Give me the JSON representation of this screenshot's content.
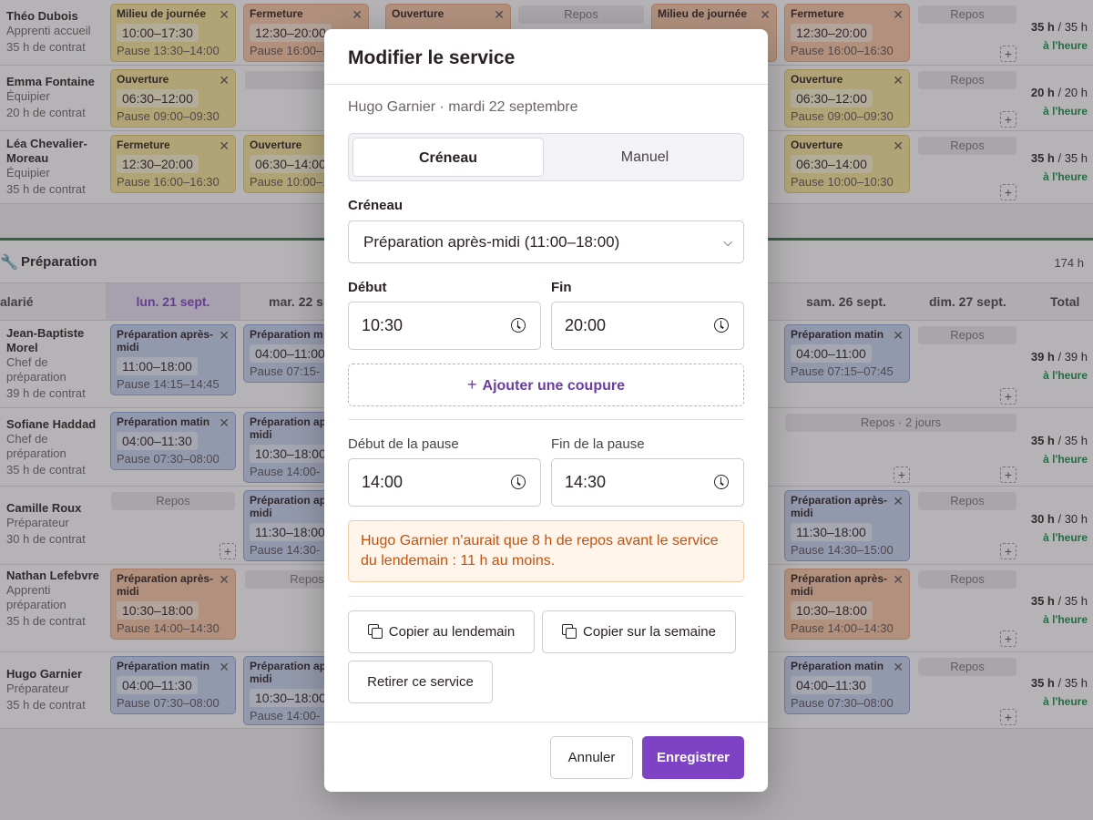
{
  "schedule": {
    "top_rows": [
      {
        "name": "Théo Dubois",
        "role": "Apprenti accueil",
        "contract": "35 h de contrat",
        "total": "35 h / 35 h",
        "total_bold": "35 h",
        "total_rest": " / 35 h",
        "status": "à l'heure"
      },
      {
        "name": "Emma Fontaine",
        "role": "Équipier",
        "contract": "20 h de contrat",
        "total_bold": "20 h",
        "total_rest": " / 20 h",
        "status": "à l'heure"
      },
      {
        "name": "Léa Chevalier-Moreau",
        "role": "Équipier",
        "contract": "35 h de contrat",
        "total_bold": "35 h",
        "total_rest": " / 35 h",
        "status": "à l'heure"
      }
    ],
    "top_shifts": [
      {
        "title": "Milieu de journée",
        "time": "10:00–17:30",
        "pause": "Pause 13:30–14:00"
      },
      {
        "title": "Fermeture",
        "time": "12:30–20:00",
        "pause": "Pause 16:00–16:30"
      },
      {
        "title": "Ouverture",
        "time": "",
        "pause": ""
      },
      {
        "title": "Milieu de journée",
        "time": "",
        "pause": ""
      },
      {
        "title": "Fermeture",
        "time": "12:30–20:00",
        "pause": "Pause 16:00–16:30"
      },
      {
        "title": "Ouverture",
        "time": "06:30–12:00",
        "pause": "Pause 09:00–09:30"
      },
      {
        "title": "Ouverture",
        "time": "06:30–12:00",
        "pause": "Pause 09:00–09:30"
      },
      {
        "title": "Fermeture",
        "time": "12:30–20:00",
        "pause": "Pause 16:00–16:30"
      },
      {
        "title": "Ouverture",
        "time": "06:30–14:00",
        "pause": "Pause 10:00–10:30"
      },
      {
        "title": "Ouverture",
        "time": "06:30–14:00",
        "pause": "Pause 10:00–10:30"
      }
    ],
    "repos_label": "Repos",
    "repos_two_days": "Repos · 2 jours",
    "section": {
      "name": "Préparation",
      "hours": "174 h"
    },
    "columns": {
      "employee": "alarié",
      "mon": "lun. 21 sept.",
      "tue": "mar. 22 s",
      "sat": "sam. 26 sept.",
      "sun": "dim. 27 sept.",
      "total": "Total"
    },
    "prep_rows": [
      {
        "name": "Jean-Baptiste Morel",
        "role": "Chef de préparation",
        "contract": "39 h de contrat",
        "total_bold": "39 h",
        "total_rest": " / 39 h",
        "status": "à l'heure"
      },
      {
        "name": "Sofiane Haddad",
        "role": "Chef de préparation",
        "contract": "35 h de contrat",
        "total_bold": "35 h",
        "total_rest": " / 35 h",
        "status": "à l'heure"
      },
      {
        "name": "Camille Roux",
        "role": "Préparateur",
        "contract": "30 h de contrat",
        "total_bold": "30 h",
        "total_rest": " / 30 h",
        "status": "à l'heure"
      },
      {
        "name": "Nathan Lefebvre",
        "role": "Apprenti préparation",
        "contract": "35 h de contrat",
        "total_bold": "35 h",
        "total_rest": " / 35 h",
        "status": "à l'heure"
      },
      {
        "name": "Hugo Garnier",
        "role": "Préparateur",
        "contract": "35 h de contrat",
        "total_bold": "35 h",
        "total_rest": " / 35 h",
        "status": "à l'heure"
      }
    ],
    "prep_shifts": [
      {
        "title": "Préparation après-midi",
        "time": "11:00–18:00",
        "pause": "Pause 14:15–14:45"
      },
      {
        "title": "Préparation m",
        "time": "04:00–11:00",
        "pause": "Pause 07:15-"
      },
      {
        "title": "Préparation matin",
        "time": "04:00–11:00",
        "pause": "Pause 07:15–07:45"
      },
      {
        "title": "Préparation matin",
        "time": "04:00–11:30",
        "pause": "Pause 07:30–08:00"
      },
      {
        "title": "Préparation après-midi",
        "time": "10:30–18:00",
        "pause": "Pause 14:00-"
      },
      {
        "title": "Préparation après-midi",
        "time": "11:30–18:00",
        "pause": "Pause 14:30-"
      },
      {
        "title": "Préparation après-midi",
        "time": "11:30–18:00",
        "pause": "Pause 14:30–15:00"
      },
      {
        "title": "Préparation après-midi",
        "time": "10:30–18:00",
        "pause": "Pause 14:00–14:30"
      },
      {
        "title": "Préparation après-midi",
        "time": "10:30–18:00",
        "pause": "Pause 14:00–14:30"
      },
      {
        "title": "Préparation matin",
        "time": "04:00–11:30",
        "pause": "Pause 07:30–08:00"
      },
      {
        "title": "Préparation après-midi",
        "time": "10:30–18:00",
        "pause": "Pause 14:00-"
      },
      {
        "title": "Préparation matin",
        "time": "04:00–11:30",
        "pause": "Pause 07:30–08:00"
      }
    ]
  },
  "modal": {
    "title": "Modifier le service",
    "subtitle": "Hugo Garnier · mardi 22 septembre",
    "mode_tabs": [
      "Créneau",
      "Manuel"
    ],
    "slot_label": "Créneau",
    "slot_value": "Préparation après-midi (11:00–18:00)",
    "start_label": "Début",
    "start_value": "10:30",
    "end_label": "Fin",
    "end_value": "20:00",
    "add_break_label": "Ajouter une coupure",
    "pause_start_label": "Début de la pause",
    "pause_start_value": "14:00",
    "pause_end_label": "Fin de la pause",
    "pause_end_value": "14:30",
    "warning": "Hugo Garnier n'aurait que 8 h de repos avant le service du lendemain : 11 h au moins.",
    "copy_next_day": "Copier au lendemain",
    "copy_week": "Copier sur la semaine",
    "remove": "Retirer ce service",
    "cancel": "Annuler",
    "save": "Enregistrer",
    "colors": {
      "accent": "#7d43c4",
      "warning_text": "#c4520f",
      "warning_bg": "#fff5ea"
    }
  }
}
